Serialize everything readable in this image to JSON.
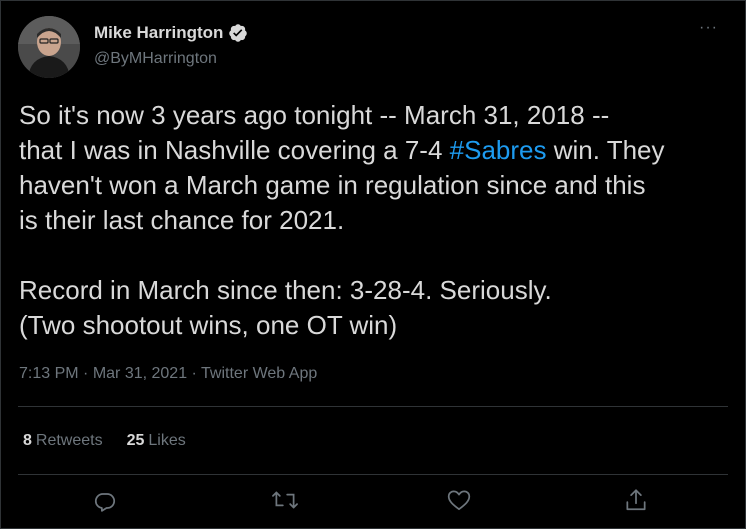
{
  "author": {
    "name": "Mike Harrington",
    "handle": "@ByMHarrington",
    "avatar_icon": "person-avatar"
  },
  "tweet": {
    "line1": "So it's now 3 years ago tonight -- March 31, 2018 --",
    "line2_prefix": "that I was in Nashville covering a 7-4 ",
    "hashtag": "#Sabres",
    "line2_suffix": " win. They",
    "line3": "haven't won a March game in regulation since and this",
    "line4": "is their last chance for 2021.",
    "line5": "Record in March since then: 3-28-4. Seriously.",
    "line6": "(Two shootout wins, one OT win)"
  },
  "meta": {
    "time": "7:13 PM",
    "date": "Mar 31, 2021",
    "source": "Twitter Web App",
    "separator": " · "
  },
  "stats": {
    "retweets_count": "8",
    "retweets_label": "Retweets",
    "likes_count": "25",
    "likes_label": "Likes"
  },
  "more_label": "···",
  "colors": {
    "background": "#000000",
    "text": "#d9d9d9",
    "secondary": "#6e767d",
    "link": "#1d9bf0",
    "divider": "#2f3336"
  },
  "actions": [
    "reply-icon",
    "retweet-icon",
    "like-icon",
    "share-icon"
  ]
}
